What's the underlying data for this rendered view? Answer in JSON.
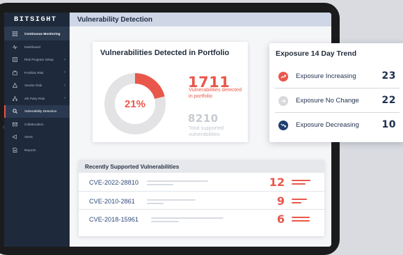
{
  "app": {
    "logo": "BITSIGHT"
  },
  "sidebar": {
    "items": [
      {
        "label": "Continuous Monitoring",
        "icon": "grid-icon",
        "chevron": false
      },
      {
        "label": "Dashboard",
        "icon": "pulse-icon",
        "chevron": false
      },
      {
        "label": "Risk Program Setup",
        "icon": "list-icon",
        "chevron": true
      },
      {
        "label": "Portfolio Risk",
        "icon": "briefcase-icon",
        "chevron": true
      },
      {
        "label": "Vendor Risk",
        "icon": "warning-icon",
        "chevron": true
      },
      {
        "label": "4th Party Risk",
        "icon": "org-icon",
        "chevron": true
      },
      {
        "label": "Vulnerability Detection",
        "icon": "search-icon",
        "chevron": false
      },
      {
        "label": "Collaboration",
        "icon": "mail-icon",
        "chevron": false
      },
      {
        "label": "Alerts",
        "icon": "megaphone-icon",
        "chevron": false
      },
      {
        "label": "Reports",
        "icon": "document-icon",
        "chevron": false
      }
    ]
  },
  "header": {
    "title": "Vulnerability Detection"
  },
  "vulnerabilities": {
    "title": "Vulnerabilities Detected in Portfolio",
    "percent_label": "21%",
    "percent": 0.21,
    "detected_count": "1711",
    "detected_caption": "Vulnerabilities detected in portfolio",
    "supported_count": "8210",
    "supported_caption": "Total supported vulnerabilities",
    "colors": {
      "accent": "#e9574b",
      "track": "#e3e3e5"
    }
  },
  "exposure": {
    "title": "Exposure 14 Day Trend",
    "rows": [
      {
        "label": "Exposure Increasing",
        "value": "23",
        "icon": "trend-up-icon",
        "color": "#e9574b"
      },
      {
        "label": "Exposure No Change",
        "value": "22",
        "icon": "arrow-right-icon",
        "color": "#d9d9dc"
      },
      {
        "label": "Exposure Decreasing",
        "value": "10",
        "icon": "trend-down-icon",
        "color": "#1f3f6e"
      }
    ]
  },
  "recent": {
    "title": "Recently Supported Vulnerabilities",
    "rows": [
      {
        "cve": "CVE-2022-28810",
        "count": "12"
      },
      {
        "cve": "CVE-2010-2861",
        "count": "9"
      },
      {
        "cve": "CVE-2018-15961",
        "count": "6"
      }
    ]
  }
}
